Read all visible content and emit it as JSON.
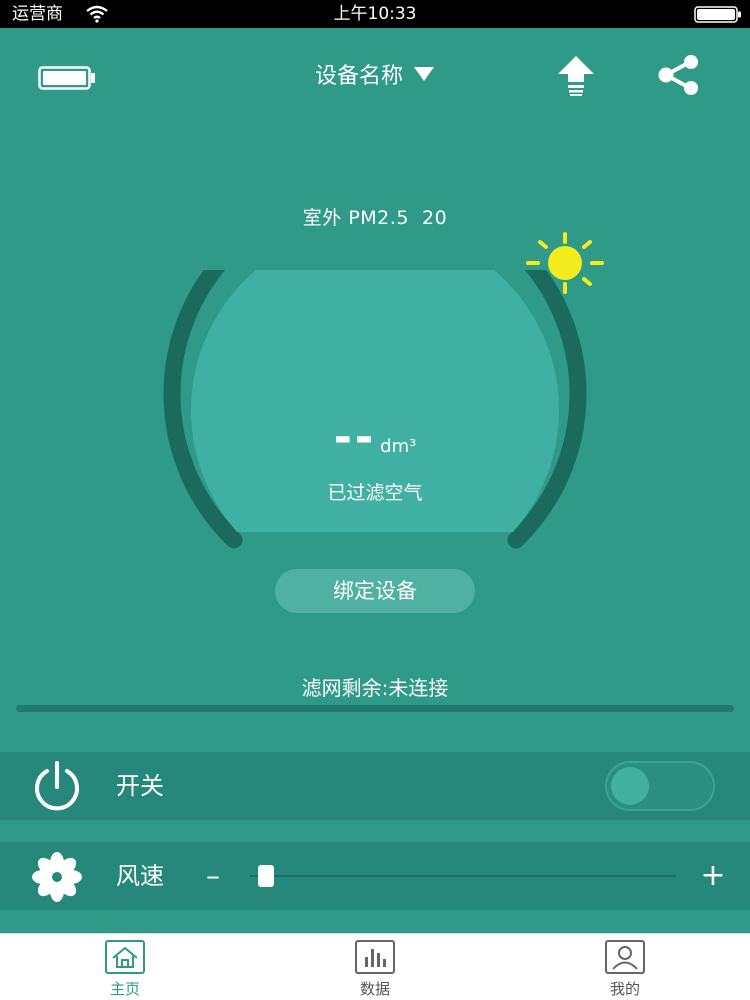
{
  "status_bar": {
    "carrier": "运营商",
    "time": "上午10:33"
  },
  "header": {
    "device_title": "设备名称",
    "icons": [
      "battery-icon",
      "caret-down-icon",
      "upload-icon",
      "share-icon"
    ]
  },
  "outdoor": {
    "label": "室外 PM2.5",
    "value": "20",
    "weather_icon": "sun-icon"
  },
  "gauge": {
    "reading": "--",
    "unit": "dm³",
    "label": "已过滤空气"
  },
  "bind_button": "绑定设备",
  "filter": {
    "label": "滤网剩余:未连接"
  },
  "controls": {
    "power_label": "开关",
    "power_on": false,
    "wind_label": "风速",
    "minus": "–",
    "plus": "+",
    "wind_level": 0.02
  },
  "colors": {
    "background": "#2e9a87",
    "accent": "#2e9a87",
    "sun": "#f5ec1d"
  },
  "tabbar": {
    "home": "主页",
    "data": "数据",
    "mine": "我的"
  }
}
